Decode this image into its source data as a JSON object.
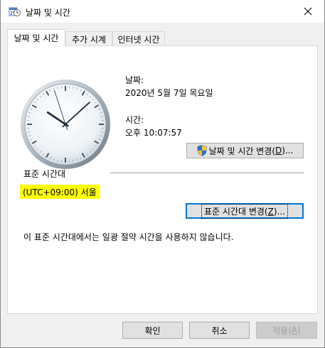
{
  "window": {
    "title": "날짜 및 시간",
    "icon": "date-time-icon",
    "close_icon": "close-icon"
  },
  "tabs": [
    {
      "label": "날짜 및 시간",
      "active": true
    },
    {
      "label": "추가 시계",
      "active": false
    },
    {
      "label": "인터넷 시간",
      "active": false
    }
  ],
  "date_section": {
    "date_label": "날짜:",
    "date_value": "2020년 5월 7일 목요일",
    "time_label": "시간:",
    "time_value": "오후 10:07:57",
    "change_button": {
      "label": "날짜 및 시간 변경(",
      "accel": "D",
      "suffix": ")...",
      "icon": "uac-shield-icon"
    }
  },
  "clock": {
    "hour": 10,
    "minute": 7,
    "second": 57
  },
  "timezone_section": {
    "heading": "표준 시간대",
    "value": "(UTC+09:00) 서울",
    "highlight_color": "#ffff00",
    "change_button": {
      "label": "표준 시간대 변경(",
      "accel": "Z",
      "suffix": ")..."
    },
    "dst_note": "이 표준 시간대에서는 일광 절약 시간을 사용하지 않습니다."
  },
  "footer": {
    "ok_label": "확인",
    "cancel_label": "취소",
    "apply": {
      "label": "적용(",
      "accel": "A",
      "suffix": ")",
      "disabled": true
    }
  },
  "colors": {
    "accent": "#0078d7",
    "panel": "#ffffff",
    "dialog": "#f0f0f0"
  }
}
